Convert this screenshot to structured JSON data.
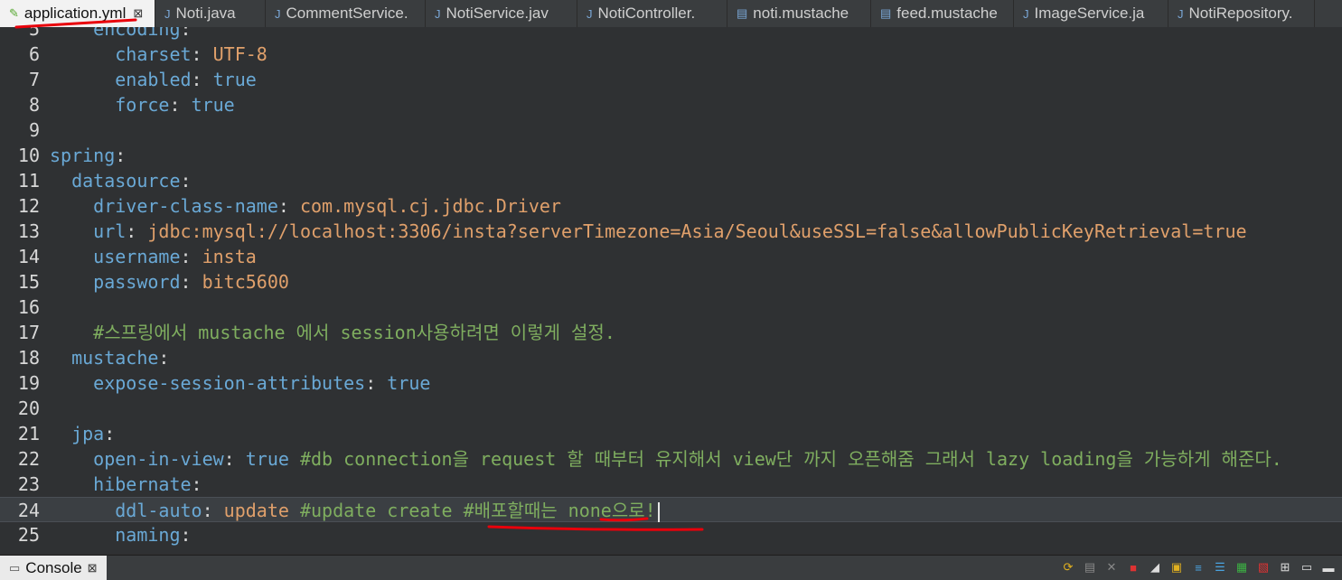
{
  "tabs": [
    {
      "label": "application.yml",
      "icon": "yaml-file-icon",
      "active": true,
      "close": "⊠"
    },
    {
      "label": "Noti.java",
      "icon": "java-file-icon"
    },
    {
      "label": "CommentService.",
      "icon": "java-file-icon"
    },
    {
      "label": "NotiService.jav",
      "icon": "java-file-icon"
    },
    {
      "label": "NotiController.",
      "icon": "java-file-icon"
    },
    {
      "label": "noti.mustache",
      "icon": "mustache-file-icon"
    },
    {
      "label": "feed.mustache",
      "icon": "mustache-file-icon"
    },
    {
      "label": "ImageService.ja",
      "icon": "java-file-icon"
    },
    {
      "label": "NotiRepository.",
      "icon": "java-file-icon"
    }
  ],
  "lines": [
    {
      "n": "5",
      "indent": "    ",
      "key": "encoding",
      "sep": ":",
      "value": "",
      "vclass": "p"
    },
    {
      "n": "6",
      "indent": "      ",
      "key": "charset",
      "sep": ": ",
      "value": "UTF-8",
      "vclass": "s"
    },
    {
      "n": "7",
      "indent": "      ",
      "key": "enabled",
      "sep": ": ",
      "value": "true",
      "vclass": "b"
    },
    {
      "n": "8",
      "indent": "      ",
      "key": "force",
      "sep": ": ",
      "value": "true",
      "vclass": "b"
    },
    {
      "n": "9",
      "indent": "",
      "key": "",
      "sep": "",
      "value": "",
      "vclass": "p"
    },
    {
      "n": "10",
      "indent": "",
      "key": "spring",
      "sep": ":",
      "value": "",
      "vclass": "p"
    },
    {
      "n": "11",
      "indent": "  ",
      "key": "datasource",
      "sep": ":",
      "value": "",
      "vclass": "p"
    },
    {
      "n": "12",
      "indent": "    ",
      "key": "driver-class-name",
      "sep": ": ",
      "value": "com.mysql.cj.jdbc.Driver",
      "vclass": "s"
    },
    {
      "n": "13",
      "indent": "    ",
      "key": "url",
      "sep": ": ",
      "value": "jdbc:mysql://localhost:3306/insta?serverTimezone=Asia/Seoul&useSSL=false&allowPublicKeyRetrieval=true",
      "vclass": "s"
    },
    {
      "n": "14",
      "indent": "    ",
      "key": "username",
      "sep": ": ",
      "value": "insta",
      "vclass": "s"
    },
    {
      "n": "15",
      "indent": "    ",
      "key": "password",
      "sep": ": ",
      "value": "bitc5600",
      "vclass": "s"
    },
    {
      "n": "16",
      "indent": "",
      "key": "",
      "sep": "",
      "value": "",
      "vclass": "p"
    },
    {
      "n": "17",
      "indent": "    ",
      "key": "",
      "sep": "",
      "value": "",
      "vclass": "p",
      "comment": "#스프링에서 mustache 에서 session사용하려면 이렇게 설정."
    },
    {
      "n": "18",
      "indent": "  ",
      "key": "mustache",
      "sep": ":",
      "value": "",
      "vclass": "p"
    },
    {
      "n": "19",
      "indent": "    ",
      "key": "expose-session-attributes",
      "sep": ": ",
      "value": "true",
      "vclass": "b"
    },
    {
      "n": "20",
      "indent": "",
      "key": "",
      "sep": "",
      "value": "",
      "vclass": "p"
    },
    {
      "n": "21",
      "indent": "  ",
      "key": "jpa",
      "sep": ":",
      "value": "",
      "vclass": "p"
    },
    {
      "n": "22",
      "indent": "    ",
      "key": "open-in-view",
      "sep": ": ",
      "value": "true",
      "vclass": "b",
      "comment": " #db connection을 request 할 때부터 유지해서 view단 까지 오픈해줌 그래서 lazy loading을 가능하게 해준다."
    },
    {
      "n": "23",
      "indent": "    ",
      "key": "hibernate",
      "sep": ":",
      "value": "",
      "vclass": "p"
    },
    {
      "n": "24",
      "indent": "      ",
      "key": "ddl-auto",
      "sep": ": ",
      "value": "update",
      "vclass": "s",
      "comment": " #update create #배포할때는 none으로!",
      "current": true
    },
    {
      "n": "25",
      "indent": "      ",
      "key": "naming",
      "sep": ":",
      "value": "",
      "vclass": "p"
    }
  ],
  "console": {
    "label": "Console",
    "close": "⊠"
  },
  "colors": {
    "annotation": "#e8000b"
  }
}
